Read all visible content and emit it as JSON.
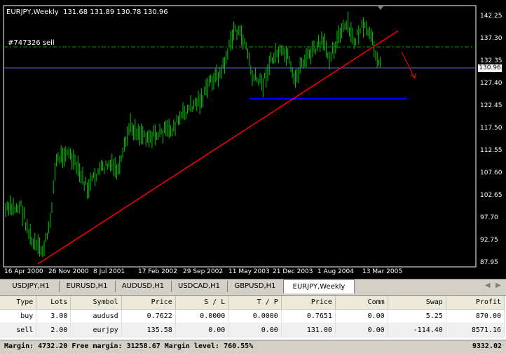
{
  "chart": {
    "header": "EURJPY,Weekly  131.68 131.89 130.78 130.96",
    "order_label": "#747326 sell",
    "current_price": "130.96",
    "price_labels": [
      "142.25",
      "137.30",
      "132.35",
      "127.40",
      "122.45",
      "117.50",
      "112.55",
      "107.60",
      "102.65",
      "97.70",
      "92.75",
      "87.95"
    ],
    "date_labels": [
      "16 Apr 2000",
      "26 Nov 2000",
      "8 Jul 2001",
      "17 Feb 2002",
      "29 Sep 2002",
      "11 May 2003",
      "21 Dec 2003",
      "1 Aug 2004",
      "13 Mar 2005"
    ],
    "colors": {
      "bg": "#000000",
      "bars": "#00c800",
      "trendline": "#ff0000",
      "support": "#0000ff",
      "order_line": "#00a000",
      "grid": "#ffffff"
    }
  },
  "tabs": [
    {
      "label": "USDJPY,H1"
    },
    {
      "label": "EURUSD,H1"
    },
    {
      "label": "AUDUSD,H1"
    },
    {
      "label": "USDCAD,H1"
    },
    {
      "label": "GBPUSD,H1"
    },
    {
      "label": "EURJPY,Weekly",
      "active": true
    }
  ],
  "terminal": {
    "columns": [
      "Type",
      "Lots",
      "Symbol",
      "Price",
      "S / L",
      "T / P",
      "Price",
      "Comm",
      "Swap",
      "Profit"
    ],
    "rows": [
      [
        "buy",
        "3.00",
        "audusd",
        "0.7622",
        "0.0000",
        "0.0000",
        "0.7651",
        "0.00",
        "5.25",
        "870.00"
      ],
      [
        "sell",
        "2.00",
        "eurjpy",
        "135.58",
        "0.00",
        "0.00",
        "131.00",
        "0.00",
        "-114.40",
        "8571.16"
      ]
    ],
    "status_left": "Margin: 4732.20  Free margin: 31258.67  Margin level: 760.55%",
    "status_right": "9332.02"
  }
}
